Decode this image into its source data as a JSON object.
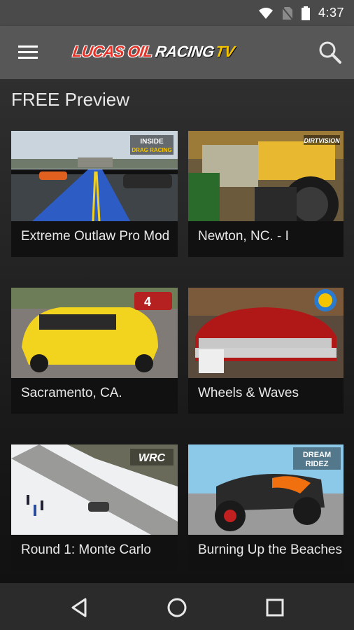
{
  "status_bar": {
    "time": "4:37"
  },
  "app_bar": {
    "logo": {
      "lucas": "LUCAS OIL",
      "racing": "RACING",
      "tv": "TV"
    },
    "menu_icon": "hamburger-menu-icon",
    "search_icon": "search-icon"
  },
  "section": {
    "title": "FREE Preview"
  },
  "cards": [
    {
      "label": "Extreme Outlaw Pro Mod",
      "badge": "INSIDE DRAG RACING"
    },
    {
      "label": "Newton, NC. - I",
      "badge": "DIRTVISION"
    },
    {
      "label": "Sacramento, CA.",
      "badge": "4"
    },
    {
      "label": "Wheels & Waves",
      "badge": ""
    },
    {
      "label": "Round 1: Monte Carlo",
      "badge": "WRC"
    },
    {
      "label": "Burning Up the Beaches",
      "badge": "DREAM RIDEZ"
    }
  ],
  "nav_bar": {
    "back_icon": "back-icon",
    "home_icon": "home-icon",
    "recents_icon": "recents-icon"
  },
  "colors": {
    "status_bar": "#4a4a4a",
    "app_bar": "#575757",
    "logo_red": "#e3342a",
    "logo_yellow": "#f5c400"
  }
}
